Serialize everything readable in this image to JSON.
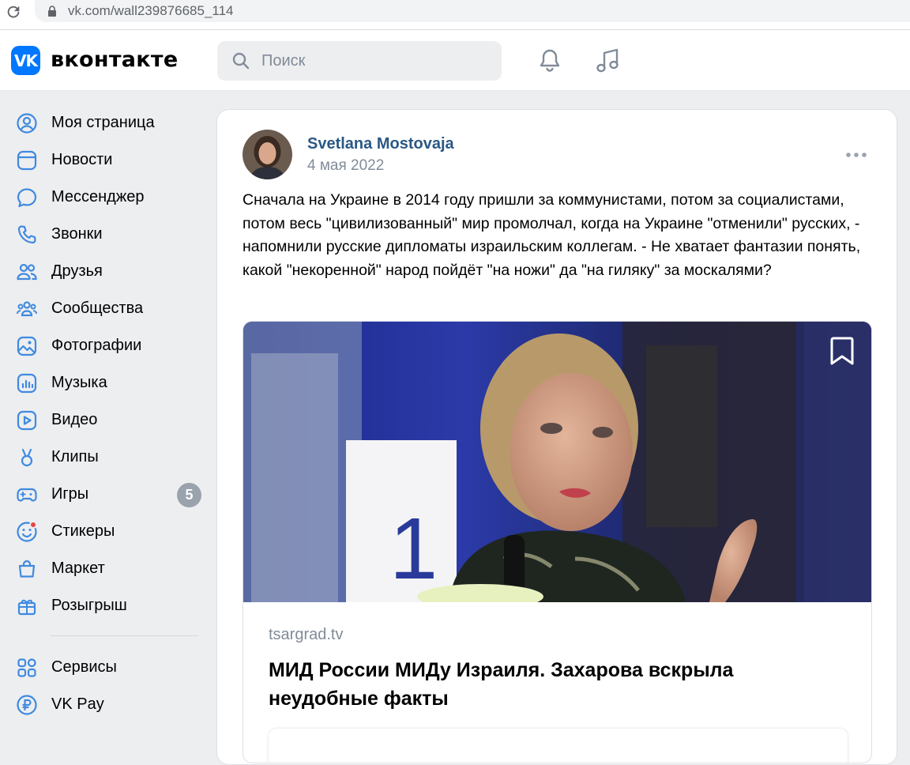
{
  "browser": {
    "url": "vk.com/wall239876685_114"
  },
  "header": {
    "logo_mark": "VK",
    "logo_text": "вконтакте",
    "search_placeholder": "Поиск"
  },
  "sidebar": {
    "items": [
      {
        "label": "Моя страница",
        "icon": "user-circle-icon"
      },
      {
        "label": "Новости",
        "icon": "newsfeed-icon"
      },
      {
        "label": "Мессенджер",
        "icon": "message-bubble-icon"
      },
      {
        "label": "Звонки",
        "icon": "phone-icon"
      },
      {
        "label": "Друзья",
        "icon": "friends-icon"
      },
      {
        "label": "Сообщества",
        "icon": "communities-icon"
      },
      {
        "label": "Фотографии",
        "icon": "photo-icon"
      },
      {
        "label": "Музыка",
        "icon": "music-icon"
      },
      {
        "label": "Видео",
        "icon": "video-icon"
      },
      {
        "label": "Клипы",
        "icon": "clips-icon"
      },
      {
        "label": "Игры",
        "icon": "gamepad-icon",
        "badge": "5"
      },
      {
        "label": "Стикеры",
        "icon": "sticker-icon",
        "dot": true
      },
      {
        "label": "Маркет",
        "icon": "market-bag-icon"
      },
      {
        "label": "Розыгрыш",
        "icon": "gift-icon"
      }
    ],
    "extra_items": [
      {
        "label": "Сервисы",
        "icon": "services-grid-icon"
      },
      {
        "label": "VK Pay",
        "icon": "vkpay-ruble-icon"
      }
    ]
  },
  "post": {
    "author": "Svetlana Mostovaja",
    "date": "4 мая 2022",
    "text": "Сначала на Украине в 2014 году пришли за коммунистами, потом за социалистами, потом весь \"цивилизованный\" мир промолчал, когда на Украине \"отменили\" русских, - напомнили русские дипломаты израильским коллегам. - Не хватает фантазии понять, какой \"некоренной\" народ пойдёт \"на ножи\" да \"на гиляку\" за москалями?",
    "attachment": {
      "source": "tsargrad.tv",
      "headline": "МИД России МИДу Израиля. Захарова вскрыла неудобные факты",
      "placard_number": "1"
    }
  },
  "colors": {
    "accent": "#0077ff",
    "link": "#2a5885",
    "icon": "#3f8ae0",
    "secondary_text": "#818c99",
    "background": "#edeef0"
  }
}
